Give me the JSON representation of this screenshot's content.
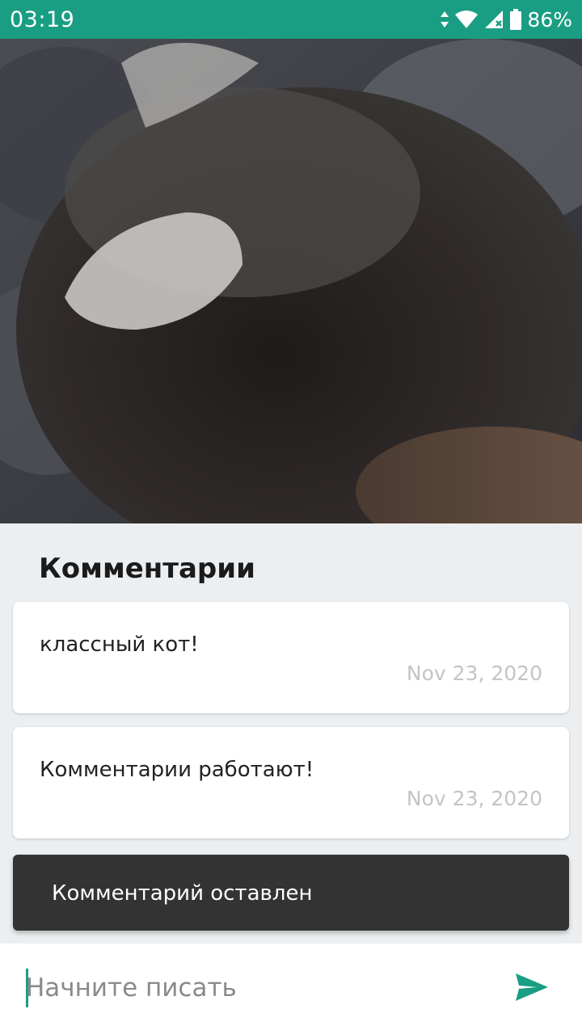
{
  "status_bar": {
    "time": "03:19",
    "battery": "86%",
    "icons": [
      "data-arrows-icon",
      "wifi-icon",
      "signal-no-sim-icon",
      "battery-icon"
    ]
  },
  "photo": {
    "subject": "cat-photo"
  },
  "comments": {
    "title": "Комментарии",
    "items": [
      {
        "text": "классный кот!",
        "date": "Nov 23, 2020"
      },
      {
        "text": "Комментарии работают!",
        "date": "Nov 23, 2020"
      }
    ]
  },
  "snackbar": {
    "message": "Комментарий оставлен"
  },
  "composer": {
    "value": "",
    "placeholder": "Начните писать",
    "send_icon": "send-icon"
  },
  "colors": {
    "accent": "#1a9e83",
    "background": "#eceff1",
    "snackbar": "#333333",
    "date_text": "#c4c4c4"
  }
}
